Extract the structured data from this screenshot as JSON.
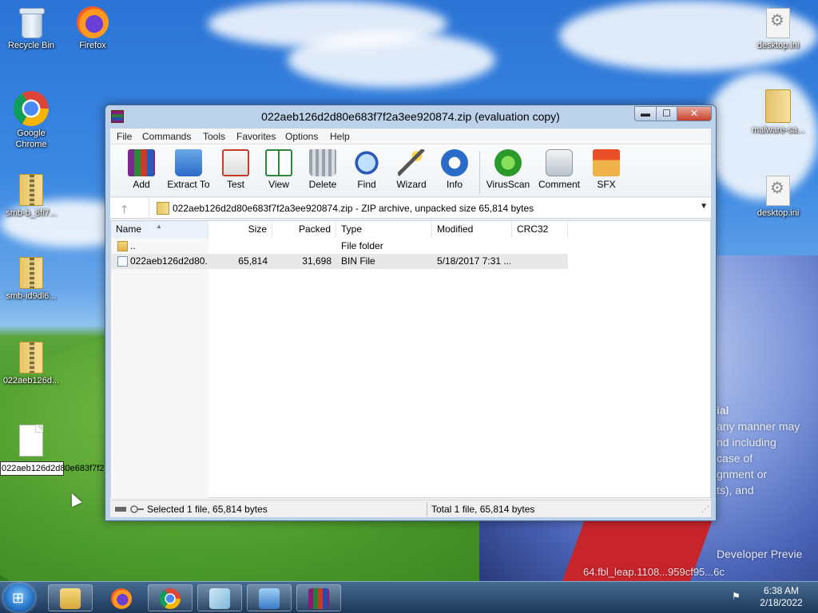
{
  "desktop": {
    "icons": {
      "recycle_bin": "Recycle Bin",
      "firefox": "Firefox",
      "chrome": "Google Chrome",
      "smb_b": "smb-b_8fi7...",
      "smb_id": "smb-id9dl6...",
      "zip_folder": "022aeb126d...",
      "renaming": "022aeb126d2d80e683f7f2a3ee920874.bin",
      "desktop_ini_1": "desktop.ini",
      "malware": "malware-sa...",
      "desktop_ini_2": "desktop.ini"
    },
    "overlay": {
      "line1": "ial",
      "line2": "any manner may",
      "line3": "nd including",
      "line4": "case of",
      "line5": "gnment or",
      "line6": "ts), and",
      "line7": "Developer Previe",
      "line8": "64.fbl_leap.1108...959cf95...6c"
    }
  },
  "window": {
    "title": "022aeb126d2d80e683f7f2a3ee920874.zip (evaluation copy)",
    "controls": {
      "minimize": "▬",
      "maximize": "☐",
      "close": "✕"
    },
    "menu": [
      "File",
      "Commands",
      "Tools",
      "Favorites",
      "Options",
      "Help"
    ],
    "toolbar": [
      "Add",
      "Extract To",
      "Test",
      "View",
      "Delete",
      "Find",
      "Wizard",
      "Info",
      "VirusScan",
      "Comment",
      "SFX"
    ],
    "address": {
      "up": "🡑",
      "path": "022aeb126d2d80e683f7f2a3ee920874.zip - ZIP archive, unpacked size 65,814 bytes",
      "dropdown": "▼"
    },
    "columns": [
      "Name",
      "Size",
      "Packed",
      "Type",
      "Modified",
      "CRC32"
    ],
    "rows": [
      {
        "name": "..",
        "size": "",
        "packed": "",
        "type": "File folder",
        "modified": "",
        "crc": ""
      },
      {
        "name": "022aeb126d2d80...",
        "size": "65,814",
        "packed": "31,698",
        "type": "BIN File",
        "modified": "5/18/2017 7:31 ...",
        "crc": ""
      }
    ],
    "status": {
      "left": "Selected 1 file, 65,814 bytes",
      "right": "Total 1 file, 65,814 bytes"
    }
  },
  "taskbar": {
    "start_glyph": "⊞",
    "clock_time": "6:38 AM",
    "clock_date": "2/18/2022",
    "tray_glyph": "⚑"
  },
  "colors": {
    "window_frame": "#bcd1ea",
    "selection": "#e8e8e8",
    "close_button": "#c7402c"
  },
  "icons": {
    "toolbar": [
      "add-icon",
      "extract-to-icon",
      "test-icon",
      "view-icon",
      "delete-icon",
      "find-icon",
      "wizard-icon",
      "info-icon",
      "virusscan-icon",
      "comment-icon",
      "sfx-icon"
    ]
  }
}
